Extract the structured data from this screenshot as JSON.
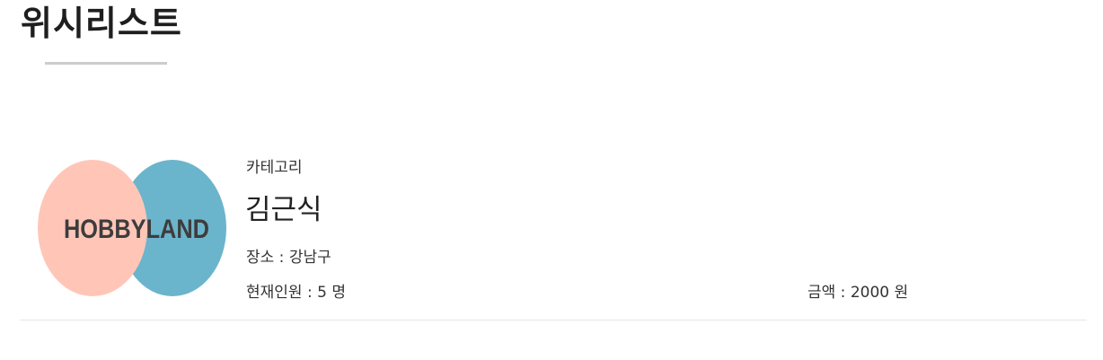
{
  "page": {
    "title": "위시리스트"
  },
  "wishlist": {
    "items": [
      {
        "logo_text": "HOBBYLAND",
        "category": "카테고리",
        "name": "김근식",
        "location": "장소 : 강남구",
        "members": "현재인원 : 5 명",
        "price": "금액 : 2000 원"
      }
    ]
  },
  "colors": {
    "logo_left_circle": "#ffc6b8",
    "logo_right_circle": "#6bb5cc",
    "logo_text": "#3d3d3d",
    "title_underline": "#cccccc",
    "divider": "#e6e6e6"
  }
}
